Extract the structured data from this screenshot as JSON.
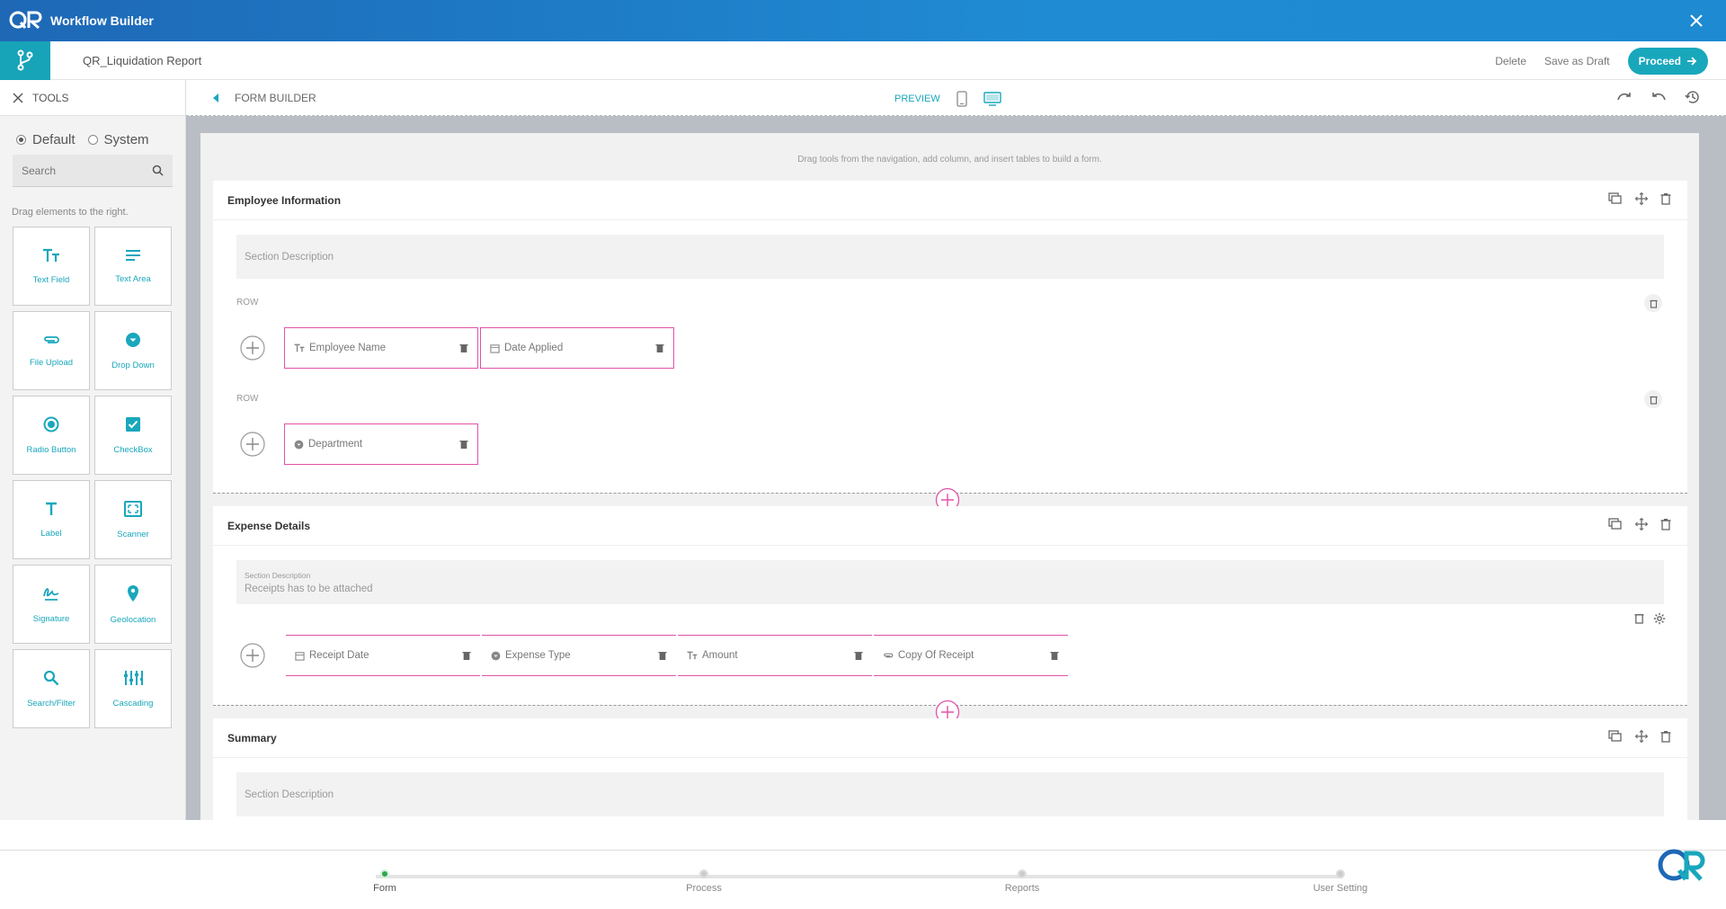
{
  "app": {
    "title": "Workflow Builder",
    "logo_text": "QR"
  },
  "colors": {
    "accent": "#19a7bc",
    "header_blue": "#1f7cc8",
    "field_border": "#e052a8",
    "active_step": "#2aa84a"
  },
  "header": {
    "report_name": "QR_Liquidation Report",
    "delete_label": "Delete",
    "save_draft_label": "Save as Draft",
    "proceed_label": "Proceed"
  },
  "sidebar": {
    "title": "TOOLS",
    "radio_default": "Default",
    "radio_system": "System",
    "selected_radio": "Default",
    "search_placeholder": "Search",
    "hint": "Drag elements to the right.",
    "tools": [
      {
        "label": "Text Field",
        "icon": "text-field-icon"
      },
      {
        "label": "Text Area",
        "icon": "text-area-icon"
      },
      {
        "label": "File Upload",
        "icon": "paperclip-icon"
      },
      {
        "label": "Drop Down",
        "icon": "dropdown-icon"
      },
      {
        "label": "Radio Button",
        "icon": "radio-button-icon"
      },
      {
        "label": "CheckBox",
        "icon": "checkbox-icon"
      },
      {
        "label": "Label",
        "icon": "label-icon"
      },
      {
        "label": "Scanner",
        "icon": "scanner-icon"
      },
      {
        "label": "Signature",
        "icon": "signature-icon"
      },
      {
        "label": "Geolocation",
        "icon": "location-pin-icon"
      },
      {
        "label": "Search/Filter",
        "icon": "search-icon"
      },
      {
        "label": "Cascading",
        "icon": "cascading-icon"
      }
    ]
  },
  "builder": {
    "title": "FORM BUILDER",
    "preview_label": "PREVIEW",
    "hint": "Drag tools from the navigation, add column, and insert tables to build a form.",
    "row_label": "ROW",
    "desc_placeholder": "Section Description",
    "sections": [
      {
        "title": "Employee Information",
        "rows": [
          {
            "fields": [
              "Employee Name",
              "Date Applied"
            ]
          },
          {
            "fields": [
              "Department"
            ]
          }
        ]
      },
      {
        "title": "Expense Details",
        "desc_label": "Section Description",
        "desc_value": "Receipts has to be attached",
        "fields": [
          "Receipt Date",
          "Expense Type",
          "Amount",
          "Copy Of Receipt"
        ]
      },
      {
        "title": "Summary"
      }
    ]
  },
  "steps": [
    {
      "label": "Form",
      "active": true
    },
    {
      "label": "Process",
      "active": false
    },
    {
      "label": "Reports",
      "active": false
    },
    {
      "label": "User Setting",
      "active": false
    }
  ]
}
